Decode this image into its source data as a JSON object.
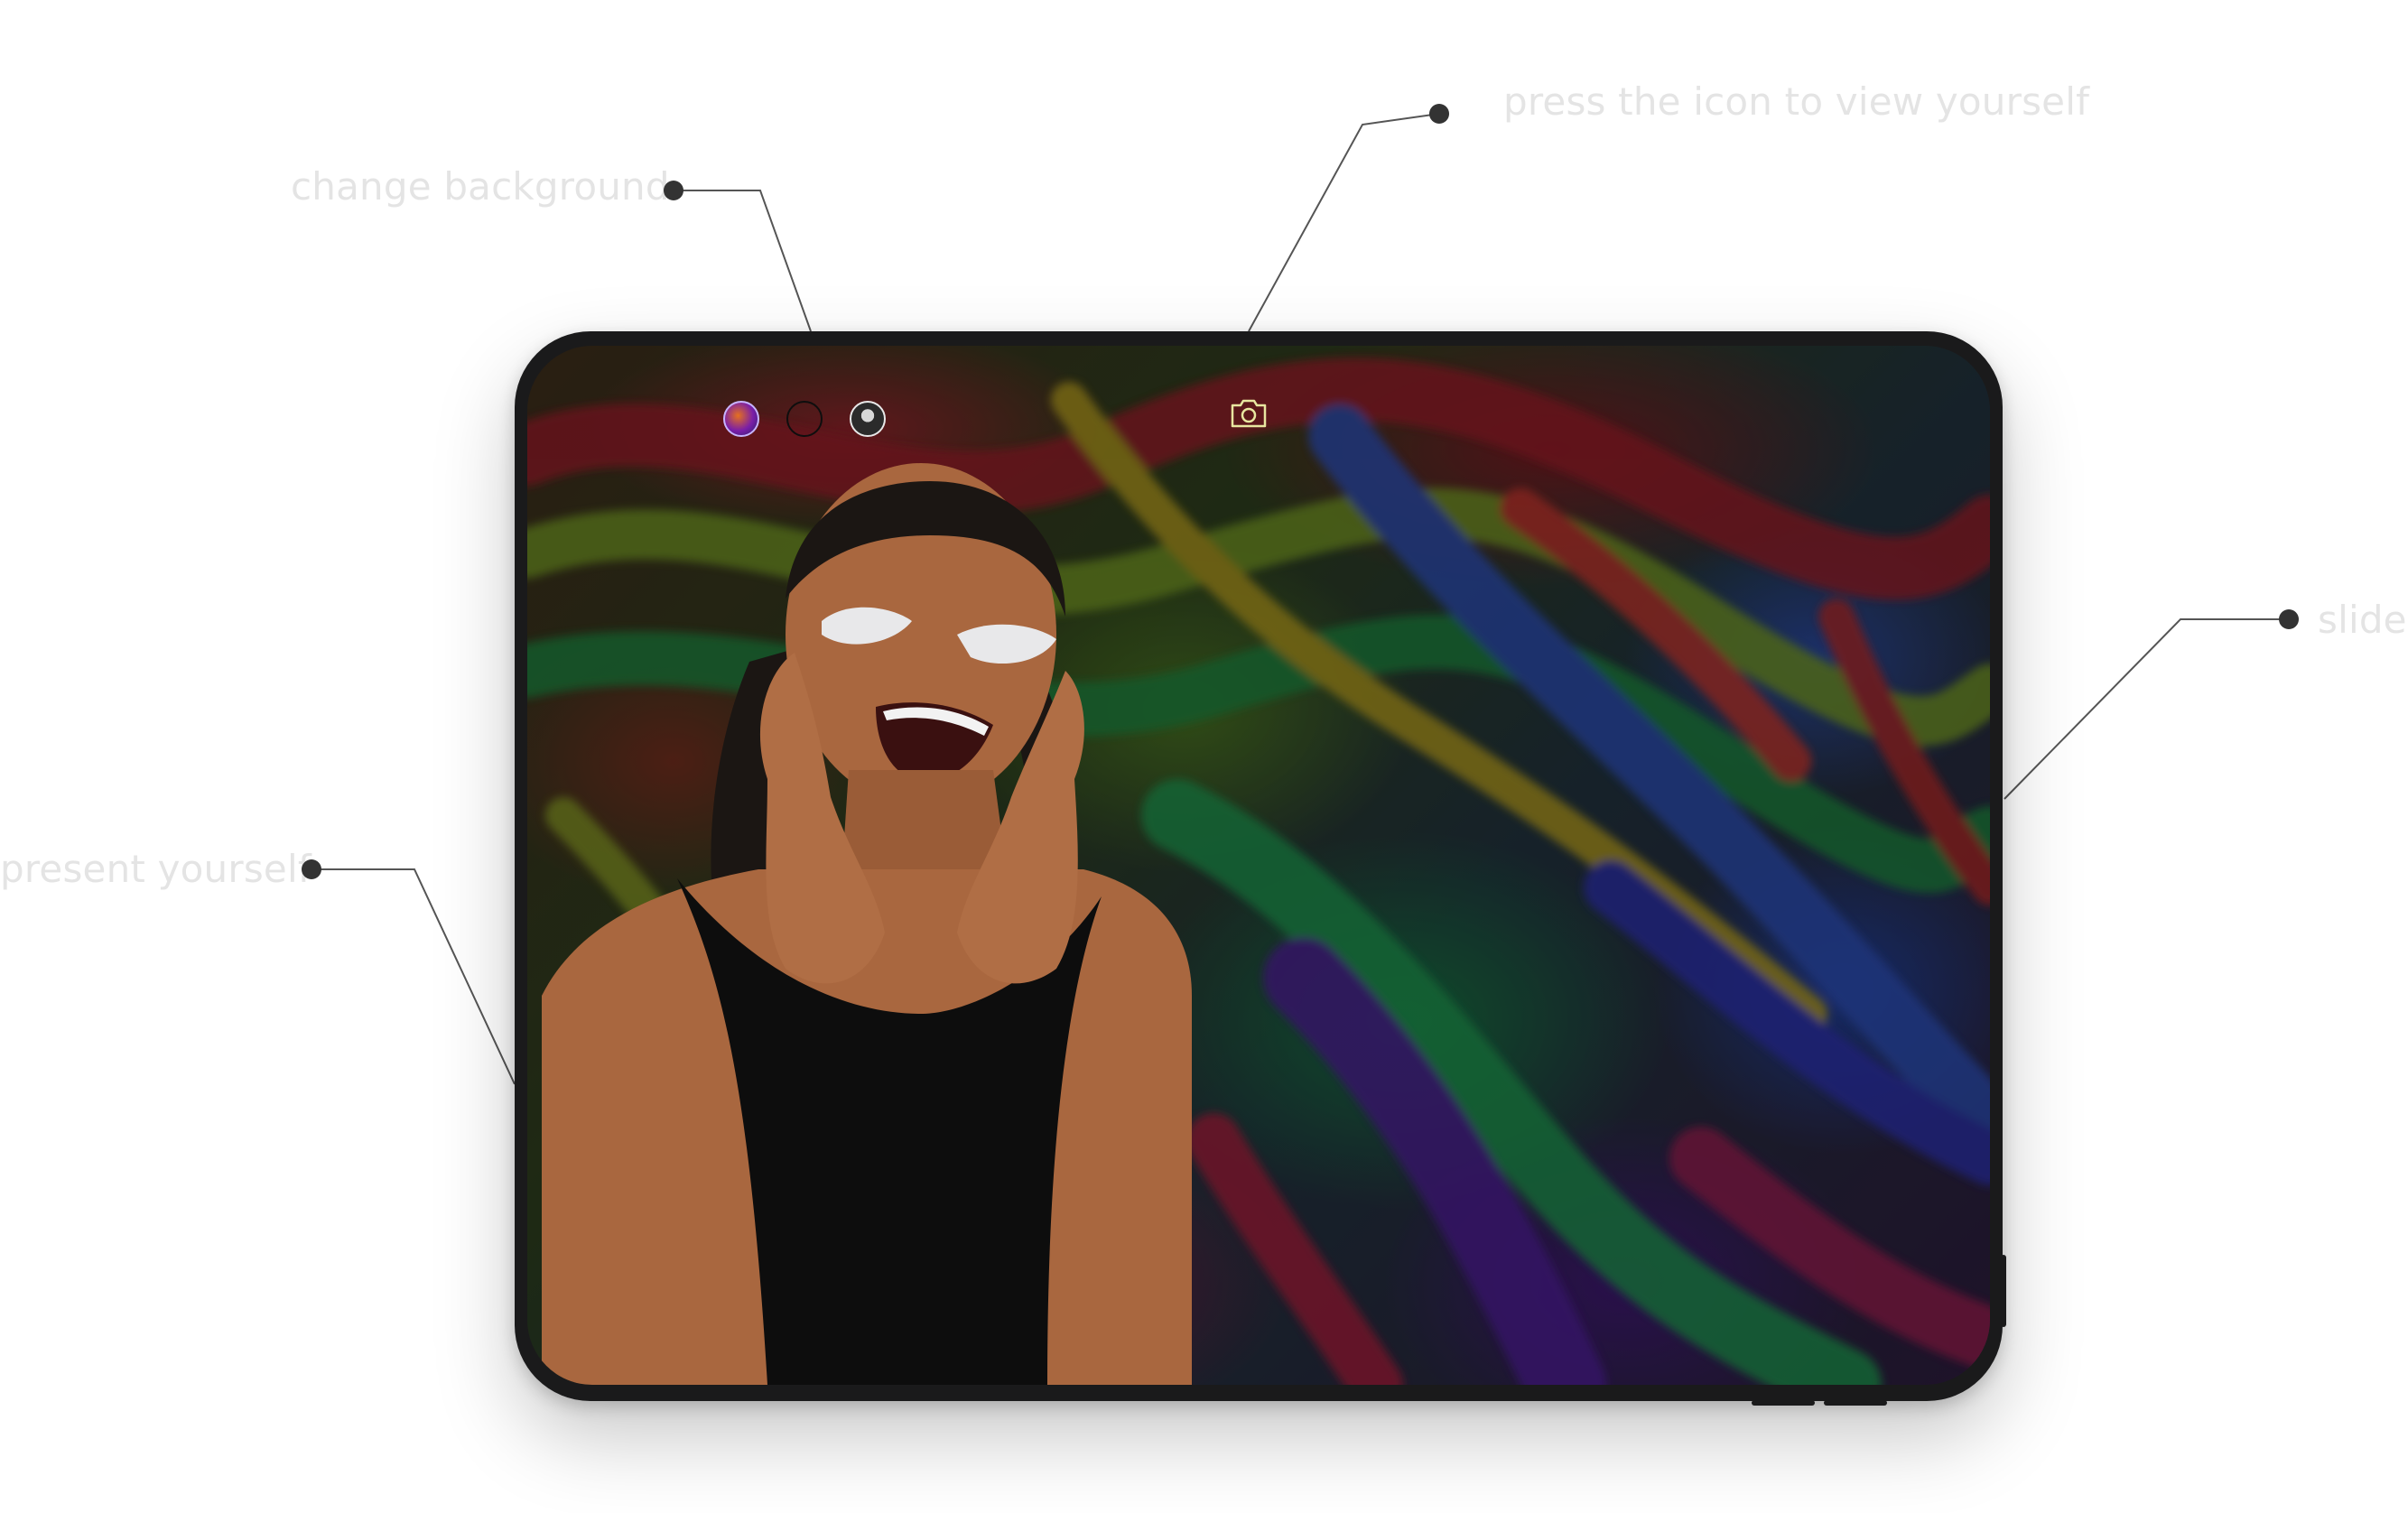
{
  "callouts": {
    "change_background": "change background",
    "view_yourself": "press the icon to view yourself",
    "present_yourself": "present yourself",
    "slides": "slides"
  },
  "screen": {
    "background_options": [
      {
        "name": "colorful-art",
        "selected": true
      },
      {
        "name": "none",
        "selected": false
      },
      {
        "name": "portrait-photo",
        "selected": false
      }
    ],
    "camera_icon": "camera-icon"
  },
  "colors": {
    "label": "#e4e4e4",
    "leader_line": "#555555",
    "dot": "#333333",
    "device_frame": "#1a1a1b",
    "camera_icon": "#e8e6a0"
  }
}
